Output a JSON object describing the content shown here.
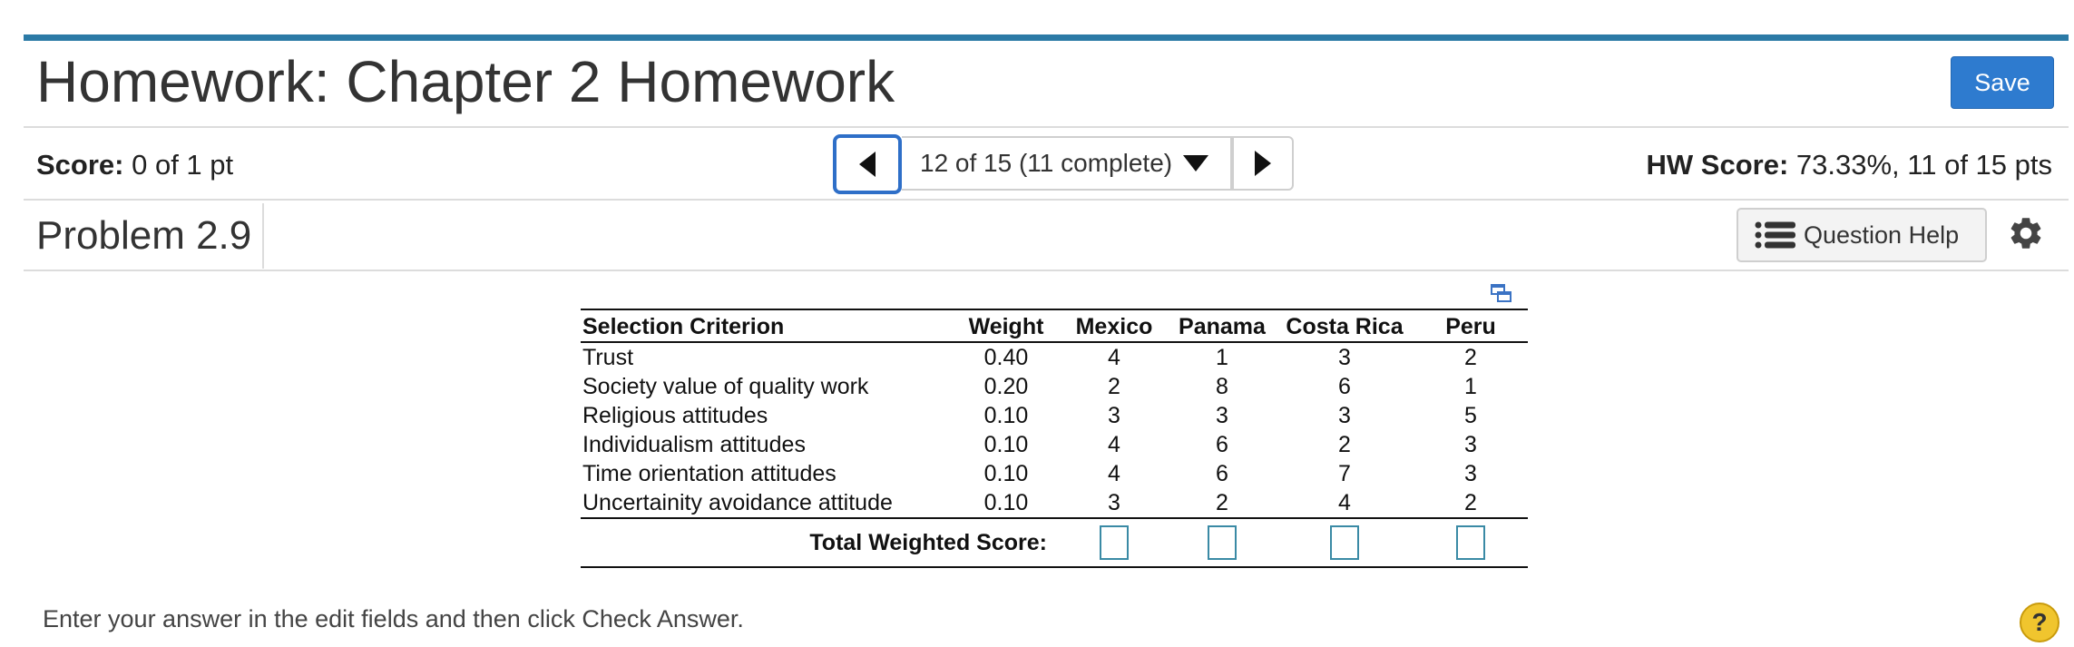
{
  "header": {
    "title": "Homework: Chapter 2 Homework",
    "save_label": "Save"
  },
  "score_bar": {
    "score_label": "Score:",
    "score_value": "0 of 1 pt",
    "nav_label": "12 of 15 (11 complete)",
    "hw_score_label": "HW Score:",
    "hw_score_value": "73.33%, 11 of 15 pts"
  },
  "problem": {
    "title": "Problem 2.9",
    "help_label": "Question Help"
  },
  "table": {
    "headers": [
      "Selection Criterion",
      "Weight",
      "Mexico",
      "Panama",
      "Costa Rica",
      "Peru"
    ],
    "rows": [
      [
        "Trust",
        "0.40",
        "4",
        "1",
        "3",
        "2"
      ],
      [
        "Society value of quality work",
        "0.20",
        "2",
        "8",
        "6",
        "1"
      ],
      [
        "Religious attitudes",
        "0.10",
        "3",
        "3",
        "3",
        "5"
      ],
      [
        "Individualism attitudes",
        "0.10",
        "4",
        "6",
        "2",
        "3"
      ],
      [
        "Time orientation attitudes",
        "0.10",
        "4",
        "6",
        "7",
        "3"
      ],
      [
        "Uncertainity avoidance attitude",
        "0.10",
        "3",
        "2",
        "4",
        "2"
      ]
    ],
    "total_label": "Total Weighted Score:"
  },
  "footer": {
    "instructions": "Enter your answer in the edit fields and then click Check Answer.",
    "help_glyph": "?"
  },
  "colors": {
    "top_bar": "#2b7aa6",
    "save_button": "#2e7bcf",
    "nav_focus": "#2e6fc8",
    "answer_box": "#3a8aa5",
    "help_circle": "#f0c52e"
  }
}
